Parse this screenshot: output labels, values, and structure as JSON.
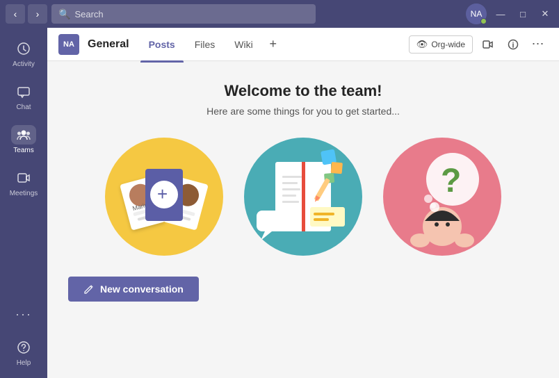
{
  "titlebar": {
    "back_label": "‹",
    "forward_label": "›",
    "search_placeholder": "Search",
    "minimize_label": "—",
    "maximize_label": "□",
    "close_label": "✕",
    "avatar_initials": "NA",
    "minimize_title": "Minimize",
    "maximize_title": "Maximize",
    "close_title": "Close"
  },
  "sidebar": {
    "items": [
      {
        "id": "activity",
        "label": "Activity",
        "icon": "🔔"
      },
      {
        "id": "chat",
        "label": "Chat",
        "icon": "💬"
      },
      {
        "id": "teams",
        "label": "Teams",
        "icon": "👥"
      },
      {
        "id": "meetings",
        "label": "Meetings",
        "icon": "📅"
      },
      {
        "id": "more",
        "label": "···",
        "icon": "···"
      }
    ],
    "bottom": [
      {
        "id": "help",
        "label": "Help",
        "icon": "?"
      }
    ],
    "active": "teams"
  },
  "channel": {
    "badge": "NA",
    "name": "General",
    "tabs": [
      {
        "id": "posts",
        "label": "Posts",
        "active": true
      },
      {
        "id": "files",
        "label": "Files",
        "active": false
      },
      {
        "id": "wiki",
        "label": "Wiki",
        "active": false
      }
    ],
    "add_tab_label": "+",
    "org_wide_label": "Org-wide",
    "toolbar": {
      "video_icon": "📹",
      "info_icon": "ℹ",
      "more_icon": "⋯"
    }
  },
  "main": {
    "welcome_title": "Welcome to the team!",
    "welcome_subtitle": "Here are some things for you to get started...",
    "new_conversation_label": "New conversation"
  }
}
